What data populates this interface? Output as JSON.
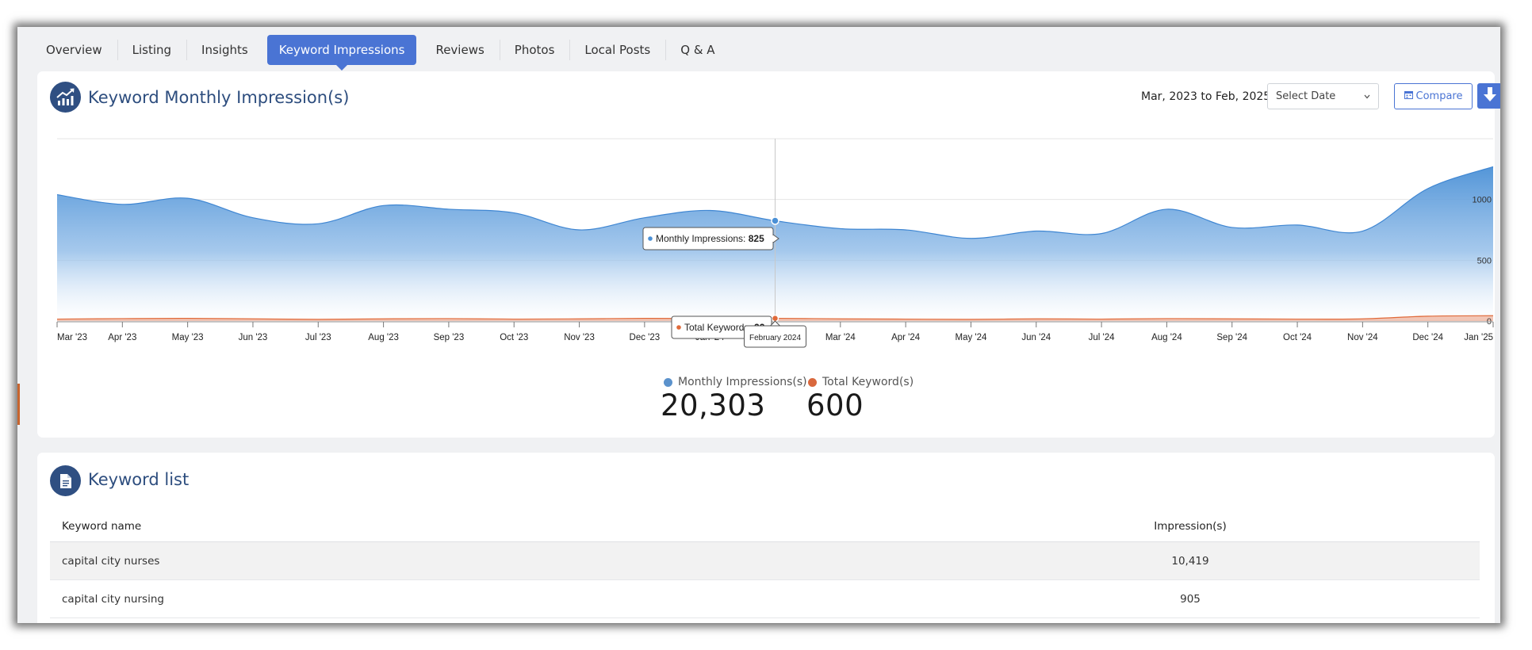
{
  "tabs": [
    "Overview",
    "Listing",
    "Insights",
    "Keyword Impressions",
    "Reviews",
    "Photos",
    "Local Posts",
    "Q & A"
  ],
  "active_tab": "Keyword Impressions",
  "impressions_section": {
    "title": "Keyword Monthly Impression(s)",
    "icon": "trend-up-chart-icon",
    "date_range": "Mar, 2023 to Feb, 2025",
    "select_date_placeholder": "Select Date",
    "compare_label": "Compare",
    "compare_icon": "calendar-icon",
    "download_icon": "download-arrow-icon"
  },
  "chart_data": {
    "type": "area",
    "x": [
      "Mar '23",
      "Apr '23",
      "May '23",
      "Jun '23",
      "Jul '23",
      "Aug '23",
      "Sep '23",
      "Oct '23",
      "Nov '23",
      "Dec '23",
      "Jan '24",
      "Feb '24",
      "Mar '24",
      "Apr '24",
      "May '24",
      "Jun '24",
      "Jul '24",
      "Aug '24",
      "Sep '24",
      "Oct '24",
      "Nov '24",
      "Dec '24",
      "Jan '25"
    ],
    "series": [
      {
        "name": "Monthly Impressions",
        "color": "#4a90d6",
        "values": [
          1040,
          960,
          1010,
          850,
          800,
          950,
          920,
          890,
          750,
          850,
          910,
          825,
          760,
          750,
          680,
          740,
          720,
          920,
          770,
          790,
          740,
          1090,
          1270
        ]
      },
      {
        "name": "Total Keywords",
        "color": "#e06a3a",
        "values": [
          16,
          20,
          22,
          18,
          14,
          18,
          20,
          16,
          18,
          22,
          20,
          22,
          18,
          16,
          14,
          18,
          16,
          20,
          18,
          16,
          18,
          40,
          44
        ]
      }
    ],
    "y_ticks": [
      0,
      500,
      1000
    ],
    "ylim": [
      0,
      1500
    ],
    "grid": true,
    "tooltip": {
      "month": "February 2024",
      "impressions_label": "Monthly Impressions: ",
      "impressions_value": "825",
      "keywords_label": "Total Keywords: ",
      "keywords_value": "22"
    }
  },
  "totals": [
    {
      "label": "Monthly Impressions(s)",
      "value": "20,303",
      "color": "#5b92cc"
    },
    {
      "label": "Total Keyword(s)",
      "value": "600",
      "color": "#d9683d"
    }
  ],
  "keyword_list": {
    "title": "Keyword list",
    "icon": "document-icon",
    "columns": [
      "Keyword name",
      "Impression(s)"
    ],
    "rows": [
      {
        "name": "capital city nurses",
        "impressions": "10,419"
      },
      {
        "name": "capital city nursing",
        "impressions": "905"
      }
    ]
  }
}
